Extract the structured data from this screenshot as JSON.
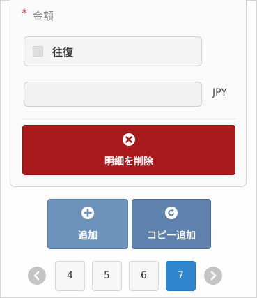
{
  "form": {
    "required_mark": "*",
    "amount_label": "金額",
    "round_trip_label": "往復",
    "amount_value": "",
    "currency": "JPY",
    "delete_label": "明細を削除"
  },
  "actions": {
    "add_label": "追加",
    "copy_add_label": "コピー追加"
  },
  "pagination": {
    "pages": [
      "4",
      "5",
      "6",
      "7"
    ],
    "current": "7"
  },
  "colors": {
    "danger": "#aa1a1d",
    "action": "#6d93bd",
    "active_page": "#2f86cf"
  }
}
